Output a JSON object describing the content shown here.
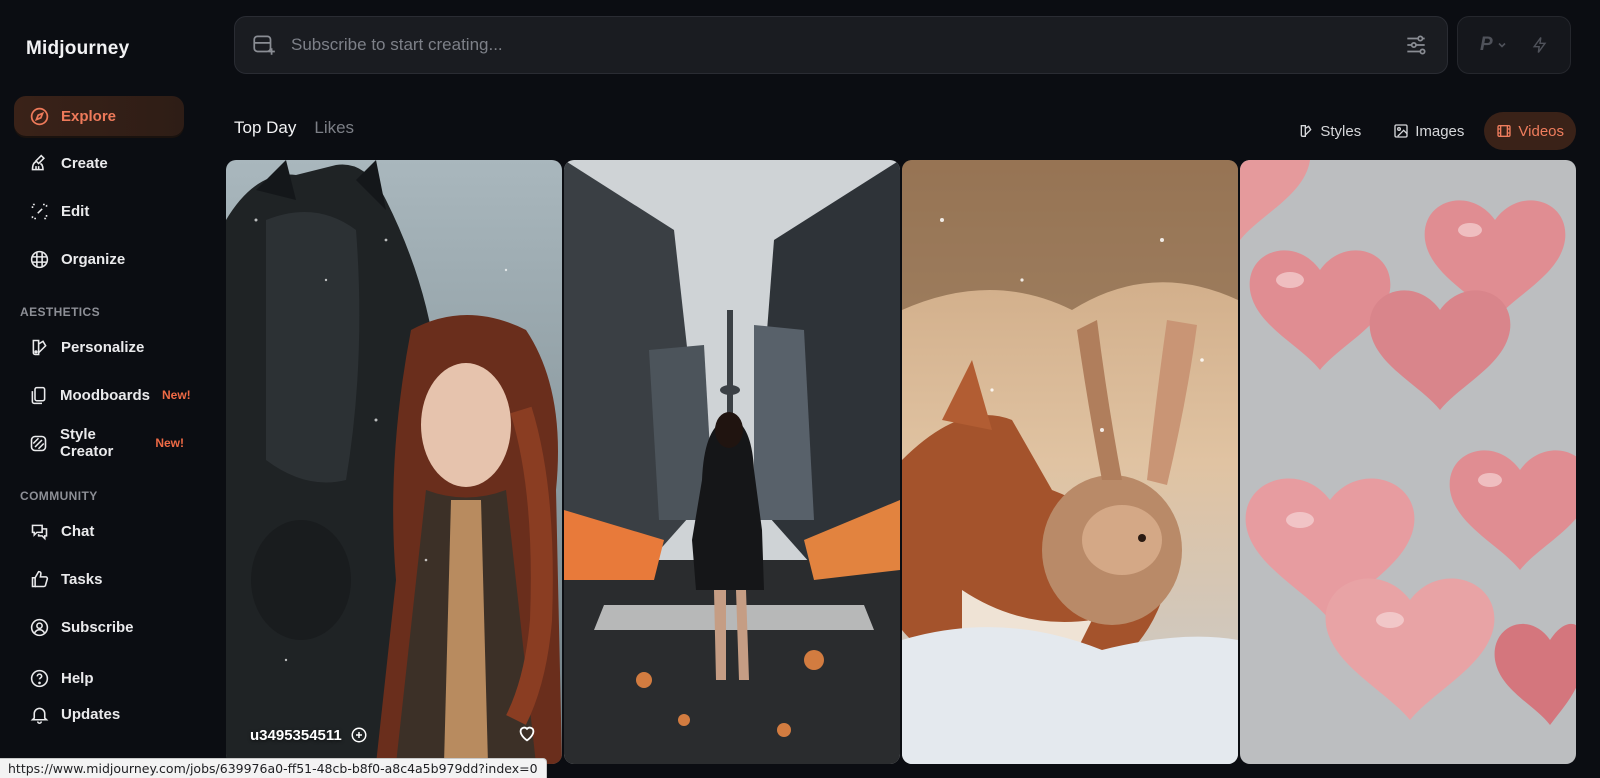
{
  "app": {
    "logo": "Midjourney"
  },
  "sidebar": {
    "items": [
      {
        "id": "explore",
        "label": "Explore",
        "icon": "compass-icon",
        "active": true
      },
      {
        "id": "create",
        "label": "Create",
        "icon": "brush-icon"
      },
      {
        "id": "edit",
        "label": "Edit",
        "icon": "edit-frame-icon"
      },
      {
        "id": "organize",
        "label": "Organize",
        "icon": "grid-icon"
      }
    ],
    "aesthetics_label": "AESTHETICS",
    "aesthetics": [
      {
        "id": "personalize",
        "label": "Personalize",
        "icon": "palette-icon"
      },
      {
        "id": "moodboards",
        "label": "Moodboards",
        "icon": "cards-icon",
        "badge": "New!"
      },
      {
        "id": "style-creator",
        "label": "Style Creator",
        "icon": "style-icon",
        "badge": "New!"
      }
    ],
    "community_label": "COMMUNITY",
    "community": [
      {
        "id": "chat",
        "label": "Chat",
        "icon": "chat-icon"
      },
      {
        "id": "tasks",
        "label": "Tasks",
        "icon": "thumbs-up-icon"
      },
      {
        "id": "subscribe",
        "label": "Subscribe",
        "icon": "user-circle-icon"
      }
    ],
    "bottom": [
      {
        "id": "help",
        "label": "Help",
        "icon": "help-icon"
      },
      {
        "id": "updates",
        "label": "Updates",
        "icon": "bell-icon"
      }
    ]
  },
  "prompt": {
    "placeholder": "Subscribe to start creating..."
  },
  "mode": {
    "label": "P"
  },
  "tabs": [
    {
      "label": "Top Day",
      "active": true
    },
    {
      "label": "Likes",
      "active": false
    }
  ],
  "filters": [
    {
      "label": "Styles",
      "icon": "styles-icon"
    },
    {
      "label": "Images",
      "icon": "image-icon"
    },
    {
      "label": "Videos",
      "icon": "film-icon",
      "active": true
    }
  ],
  "gallery": [
    {
      "subject": "woman with black horse",
      "user": "u3495354511"
    },
    {
      "subject": "woman in city with tower"
    },
    {
      "subject": "fox and rabbit in snow"
    },
    {
      "subject": "pink heart balloons"
    }
  ],
  "status_url": "https://www.midjourney.com/jobs/639976a0-ff51-48cb-b8f0-a8c4a5b979dd?index=0",
  "colors": {
    "accent": "#ef7a5a",
    "active_bg": "#3a2218",
    "background": "#0b0d12"
  }
}
